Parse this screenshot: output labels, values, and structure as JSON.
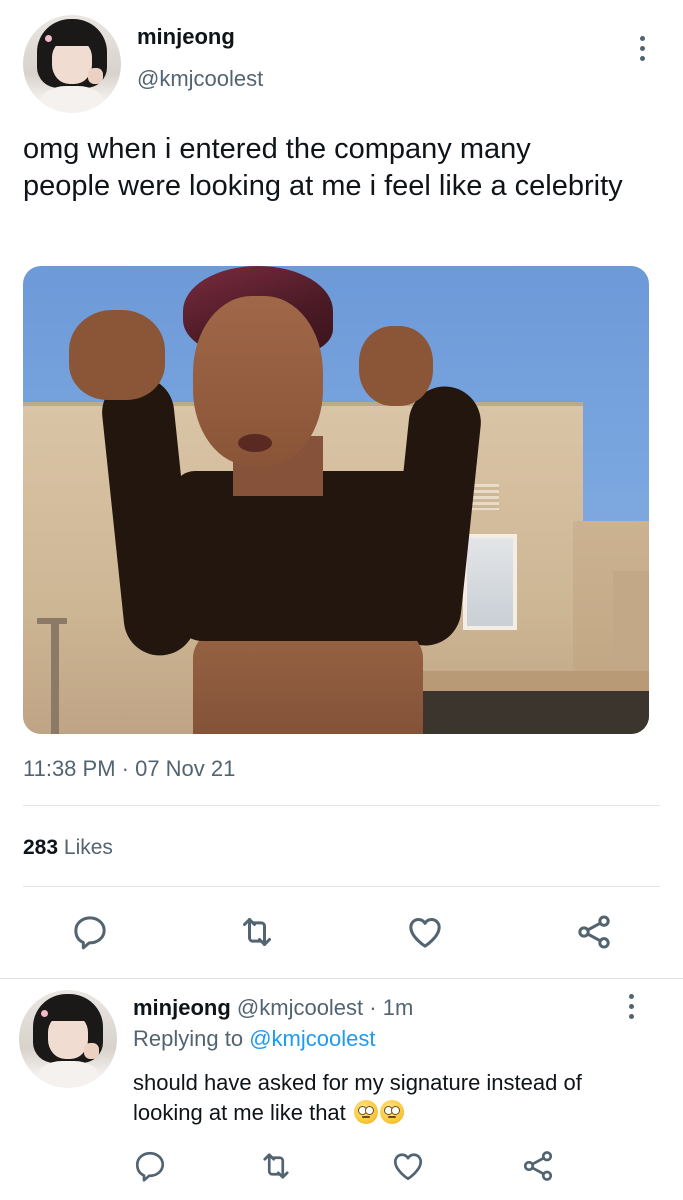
{
  "tweet": {
    "author_name": "minjeong",
    "author_handle": "@kmjcoolest",
    "text": "omg when i entered the company many people were looking at me i feel like a celebrity",
    "timestamp": "11:38 PM · 07 Nov 21",
    "likes_count": "283",
    "likes_label": "Likes",
    "more_icon": "more-vertical-icon"
  },
  "actions": [
    "reply-icon",
    "retweet-icon",
    "like-icon",
    "share-icon"
  ],
  "reply": {
    "author_name": "minjeong",
    "author_handle": "@kmjcoolest",
    "time_sep": "·",
    "time": "1m",
    "replying_prefix": "Replying to",
    "replying_to": "@kmjcoolest",
    "text": "should have asked for my signature instead of looking at me like that",
    "emojis": [
      "face-with-rolling-eyes",
      "face-with-rolling-eyes"
    ]
  },
  "colors": {
    "text": "#0f1419",
    "muted": "#536471",
    "link": "#1d9bf0",
    "divider": "#e1e6ea"
  }
}
